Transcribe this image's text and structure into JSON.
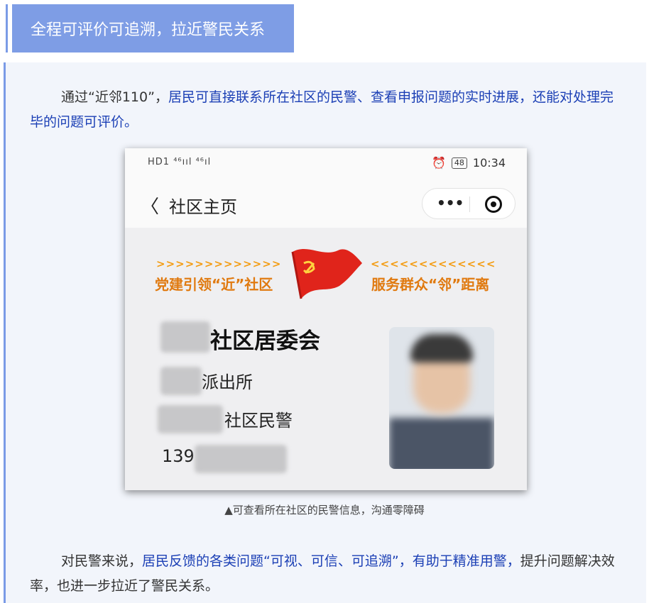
{
  "header": {
    "title": "全程可评价可追溯，拉近警民关系"
  },
  "intro": {
    "lead": "通过“近邻110”，",
    "highlight": "居民可直接联系所在社区的民警、查看申报问题的实时进展，还能对处理完毕的问题可评价。"
  },
  "phone": {
    "status_left": "HD1 ⁴⁶ııl ⁴⁶ıl",
    "battery": "48",
    "time": "10:34",
    "nav_title": "社区主页",
    "slogan_left": "党建引领“近”社区",
    "slogan_right": "服务群众“邻”距离",
    "chevrons_left": ">>>>>>>>>>>>>",
    "chevrons_right": "<<<<<<<<<<<<<",
    "org_name": "社区居委会",
    "station": "派出所",
    "police_title": "社区民警",
    "phone_prefix": "139"
  },
  "caption": "▲可查看所在社区的民警信息，沟通零障碍",
  "outro": {
    "lead": "对民警来说，",
    "highlight": "居民反馈的各类问题“可视、可信、可追溯”，有助于精准用警，",
    "tail": "提升问题解决效率，也进一步拉近了警民关系。"
  },
  "colors": {
    "accent": "#7e9de5",
    "link": "#1b3fb5",
    "slogan": "#e07a10"
  }
}
